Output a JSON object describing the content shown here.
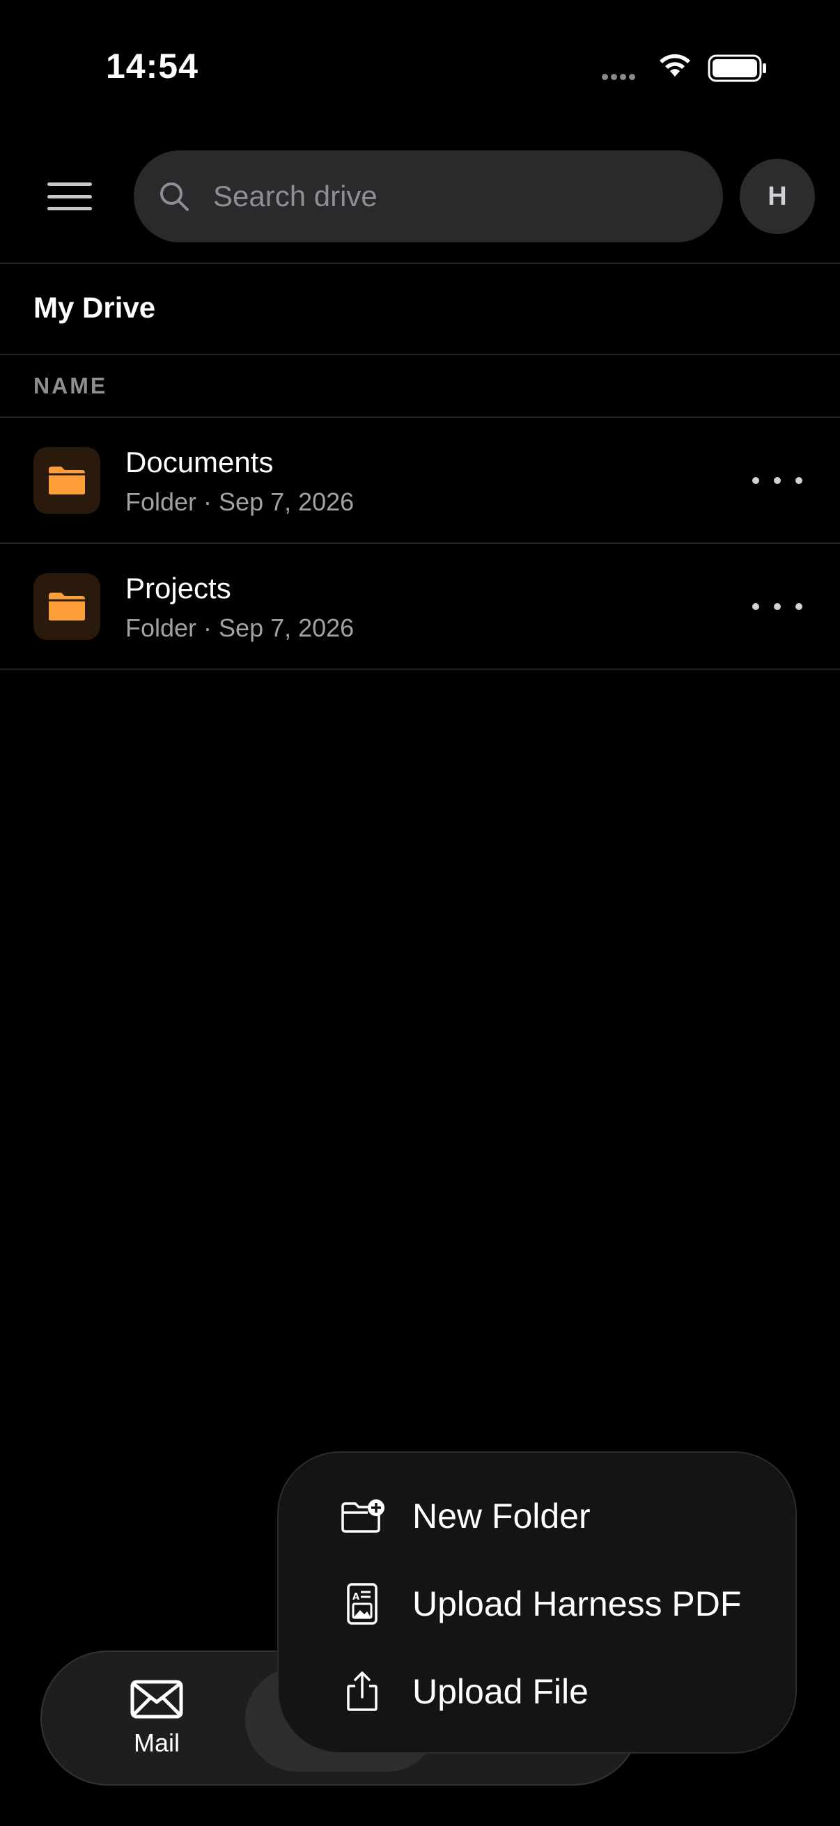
{
  "status_bar": {
    "time": "14:54",
    "icons": [
      "signal-dots-icon",
      "wifi-icon",
      "battery-icon"
    ]
  },
  "header": {
    "menu_icon": "hamburger-menu-icon",
    "search": {
      "placeholder": "Search drive",
      "icon": "search-icon"
    },
    "avatar_initial": "H"
  },
  "breadcrumb": {
    "title": "My Drive"
  },
  "list": {
    "column_header": "NAME",
    "items": [
      {
        "name": "Documents",
        "meta": "Folder · Sep 7, 2026",
        "icon": "folder-icon"
      },
      {
        "name": "Projects",
        "meta": "Folder · Sep 7, 2026",
        "icon": "folder-icon"
      }
    ]
  },
  "tab_bar": {
    "tabs": [
      {
        "label": "Mail",
        "icon": "envelope-icon"
      },
      {
        "label": "",
        "icon": "drive-icon",
        "selected": true
      }
    ]
  },
  "popup_menu": {
    "items": [
      {
        "label": "New Folder",
        "icon": "folder-plus-icon"
      },
      {
        "label": "Upload Harness PDF",
        "icon": "document-image-icon"
      },
      {
        "label": "Upload File",
        "icon": "share-upload-icon"
      }
    ]
  },
  "colors": {
    "background": "#000000",
    "folder_accent": "#ff9f3a",
    "folder_tile_bg": "#2a1a0c",
    "search_bg": "#2a2a2c",
    "secondary_text": "#a1a1a6"
  }
}
